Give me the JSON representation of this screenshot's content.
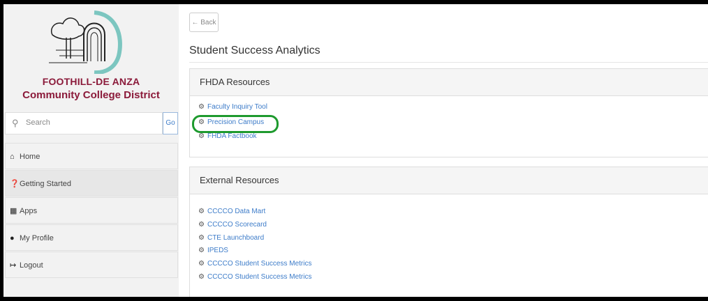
{
  "logo": {
    "line1": "FOOTHILL-DE ANZA",
    "line2": "Community College District"
  },
  "search": {
    "placeholder": "Search",
    "go_label": "Go",
    "icon": "search-icon"
  },
  "nav": [
    {
      "label": "Home",
      "icon": "home-icon",
      "glyph": "⌂"
    },
    {
      "label": "Getting Started",
      "icon": "question-circle-icon",
      "glyph": "❓"
    },
    {
      "label": "Apps",
      "icon": "grid-icon",
      "glyph": "▦"
    },
    {
      "label": "My Profile",
      "icon": "user-icon",
      "glyph": "●"
    },
    {
      "label": "Logout",
      "icon": "logout-icon",
      "glyph": "↦"
    }
  ],
  "back_label": "← Back",
  "page_title": "Student Success Analytics",
  "fhda": {
    "header": "FHDA Resources",
    "links": [
      "Faculty Inquiry Tool",
      "Precision Campus",
      "FHDA Factbook"
    ]
  },
  "external": {
    "header": "External Resources",
    "links": [
      "CCCCO Data Mart",
      "CCCCO Scorecard",
      "CTE Launchboard",
      "IPEDS",
      "CCCCO Student Success Metrics",
      "CCCCO Student Success Metrics"
    ]
  },
  "colors": {
    "brand": "#8b1a3a",
    "link": "#3d7cc9",
    "highlight": "#1e9a2e"
  }
}
